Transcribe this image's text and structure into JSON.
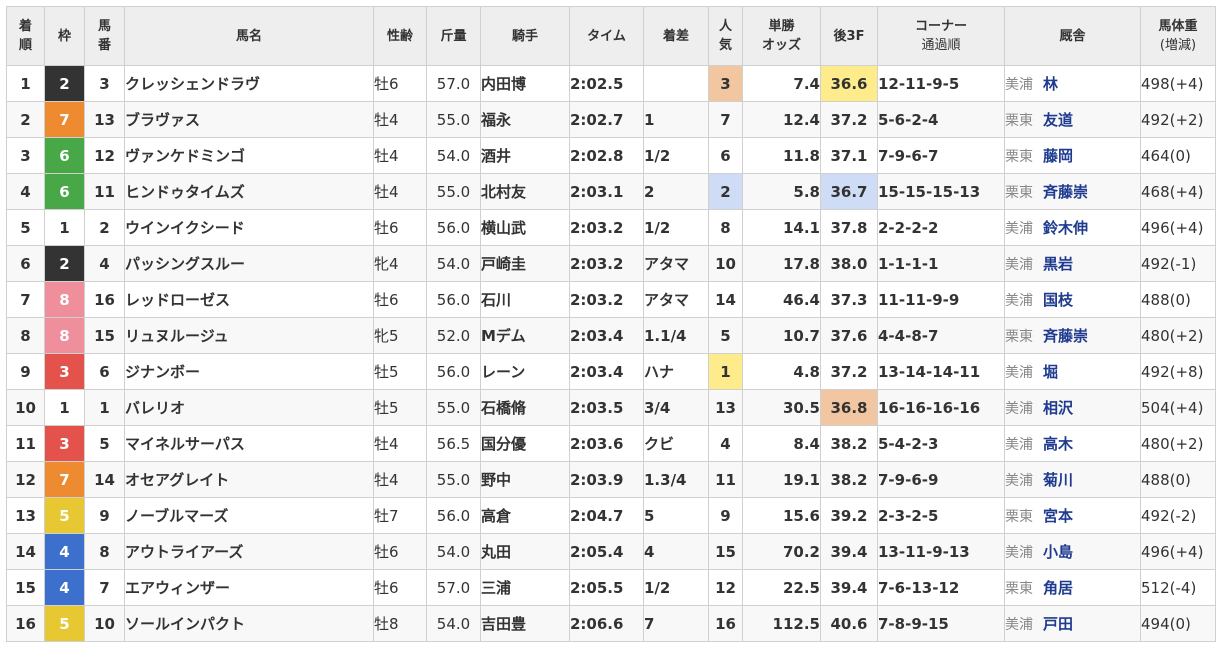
{
  "columns": [
    {
      "key": "rank",
      "label": "着\n順"
    },
    {
      "key": "frame",
      "label": "枠"
    },
    {
      "key": "num",
      "label": "馬\n番"
    },
    {
      "key": "name",
      "label": "馬名"
    },
    {
      "key": "sexage",
      "label": "性齢"
    },
    {
      "key": "wt",
      "label": "斤量"
    },
    {
      "key": "jockey",
      "label": "騎手"
    },
    {
      "key": "time",
      "label": "タイム"
    },
    {
      "key": "margin",
      "label": "着差"
    },
    {
      "key": "pop",
      "label": "人\n気"
    },
    {
      "key": "odds",
      "label": "単勝\nオッズ"
    },
    {
      "key": "last3f",
      "label": "後3F"
    },
    {
      "key": "corner",
      "label": "コーナー",
      "sub": "通過順"
    },
    {
      "key": "stable",
      "label": "厩舎"
    },
    {
      "key": "body",
      "label": "馬体重",
      "sub": "(増減)"
    }
  ],
  "colors": {
    "frames": {
      "1": {
        "bg": "#ffffff",
        "fg": "#333333"
      },
      "2": {
        "bg": "#333333",
        "fg": "#ffffff"
      },
      "3": {
        "bg": "#e4524c",
        "fg": "#ffffff"
      },
      "4": {
        "bg": "#3d6fcc",
        "fg": "#ffffff"
      },
      "5": {
        "bg": "#e8c832",
        "fg": "#ffffff"
      },
      "6": {
        "bg": "#48a848",
        "fg": "#ffffff"
      },
      "7": {
        "bg": "#ee8a30",
        "fg": "#ffffff"
      },
      "8": {
        "bg": "#ef8f9c",
        "fg": "#ffffff"
      }
    },
    "highlights": {
      "gold": "#fdeb8c",
      "bronze": "#f2c6a0",
      "blue": "#cfdcf5"
    }
  },
  "rows": [
    {
      "rank": "1",
      "frame": "2",
      "num": "3",
      "name": "クレッシェンドラヴ",
      "sexage": "牡6",
      "wt": "57.0",
      "jockey": "内田博",
      "time": "2:02.5",
      "margin": "",
      "pop": "3",
      "odds": "7.4",
      "last3f": "36.6",
      "corner": "12-11-9-5",
      "region": "美浦",
      "trainer": "林",
      "body": "498(+4)",
      "popHL": "bronze",
      "oddsHot": true,
      "l3fHL": "gold"
    },
    {
      "rank": "2",
      "frame": "7",
      "num": "13",
      "name": "ブラヴァス",
      "sexage": "牡4",
      "wt": "55.0",
      "jockey": "福永",
      "time": "2:02.7",
      "margin": "1",
      "pop": "7",
      "odds": "12.4",
      "last3f": "37.2",
      "corner": "5-6-2-4",
      "region": "栗東",
      "trainer": "友道",
      "body": "492(+2)"
    },
    {
      "rank": "3",
      "frame": "6",
      "num": "12",
      "name": "ヴァンケドミンゴ",
      "sexage": "牡4",
      "wt": "54.0",
      "jockey": "酒井",
      "time": "2:02.8",
      "margin": "1/2",
      "pop": "6",
      "odds": "11.8",
      "last3f": "37.1",
      "corner": "7-9-6-7",
      "region": "栗東",
      "trainer": "藤岡",
      "body": "464(0)"
    },
    {
      "rank": "4",
      "frame": "6",
      "num": "11",
      "name": "ヒンドゥタイムズ",
      "sexage": "牡4",
      "wt": "55.0",
      "jockey": "北村友",
      "time": "2:03.1",
      "margin": "2",
      "pop": "2",
      "odds": "5.8",
      "last3f": "36.7",
      "corner": "15-15-15-13",
      "region": "栗東",
      "trainer": "斉藤崇",
      "body": "468(+4)",
      "popHL": "blue",
      "oddsHot": true,
      "l3fHL": "blue"
    },
    {
      "rank": "5",
      "frame": "1",
      "num": "2",
      "name": "ウインイクシード",
      "sexage": "牡6",
      "wt": "56.0",
      "jockey": "横山武",
      "time": "2:03.2",
      "margin": "1/2",
      "pop": "8",
      "odds": "14.1",
      "last3f": "37.8",
      "corner": "2-2-2-2",
      "region": "美浦",
      "trainer": "鈴木伸",
      "body": "496(+4)"
    },
    {
      "rank": "6",
      "frame": "2",
      "num": "4",
      "name": "パッシングスルー",
      "sexage": "牝4",
      "wt": "54.0",
      "jockey": "戸崎圭",
      "time": "2:03.2",
      "margin": "アタマ",
      "pop": "10",
      "odds": "17.8",
      "last3f": "38.0",
      "corner": "1-1-1-1",
      "region": "美浦",
      "trainer": "黒岩",
      "body": "492(-1)"
    },
    {
      "rank": "7",
      "frame": "8",
      "num": "16",
      "name": "レッドローゼス",
      "sexage": "牡6",
      "wt": "56.0",
      "jockey": "石川",
      "time": "2:03.2",
      "margin": "アタマ",
      "pop": "14",
      "odds": "46.4",
      "last3f": "37.3",
      "corner": "11-11-9-9",
      "region": "美浦",
      "trainer": "国枝",
      "body": "488(0)"
    },
    {
      "rank": "8",
      "frame": "8",
      "num": "15",
      "name": "リュヌルージュ",
      "sexage": "牝5",
      "wt": "52.0",
      "jockey": "Mデム",
      "time": "2:03.4",
      "margin": "1.1/4",
      "pop": "5",
      "odds": "10.7",
      "last3f": "37.6",
      "corner": "4-4-8-7",
      "region": "栗東",
      "trainer": "斉藤崇",
      "body": "480(+2)"
    },
    {
      "rank": "9",
      "frame": "3",
      "num": "6",
      "name": "ジナンボー",
      "sexage": "牡5",
      "wt": "56.0",
      "jockey": "レーン",
      "time": "2:03.4",
      "margin": "ハナ",
      "pop": "1",
      "odds": "4.8",
      "last3f": "37.2",
      "corner": "13-14-14-11",
      "region": "美浦",
      "trainer": "堀",
      "body": "492(+8)",
      "popHL": "gold",
      "oddsHot": true
    },
    {
      "rank": "10",
      "frame": "1",
      "num": "1",
      "name": "バレリオ",
      "sexage": "牡5",
      "wt": "55.0",
      "jockey": "石橋脩",
      "time": "2:03.5",
      "margin": "3/4",
      "pop": "13",
      "odds": "30.5",
      "last3f": "36.8",
      "corner": "16-16-16-16",
      "region": "美浦",
      "trainer": "相沢",
      "body": "504(+4)",
      "l3fHL": "bronze"
    },
    {
      "rank": "11",
      "frame": "3",
      "num": "5",
      "name": "マイネルサーパス",
      "sexage": "牡4",
      "wt": "56.5",
      "jockey": "国分優",
      "time": "2:03.6",
      "margin": "クビ",
      "pop": "4",
      "odds": "8.4",
      "last3f": "38.2",
      "corner": "5-4-2-3",
      "region": "美浦",
      "trainer": "高木",
      "body": "480(+2)",
      "oddsHot": true
    },
    {
      "rank": "12",
      "frame": "7",
      "num": "14",
      "name": "オセアグレイト",
      "sexage": "牡4",
      "wt": "55.0",
      "jockey": "野中",
      "time": "2:03.9",
      "margin": "1.3/4",
      "pop": "11",
      "odds": "19.1",
      "last3f": "38.2",
      "corner": "7-9-6-9",
      "region": "美浦",
      "trainer": "菊川",
      "body": "488(0)"
    },
    {
      "rank": "13",
      "frame": "5",
      "num": "9",
      "name": "ノーブルマーズ",
      "sexage": "牡7",
      "wt": "56.0",
      "jockey": "高倉",
      "time": "2:04.7",
      "margin": "5",
      "pop": "9",
      "odds": "15.6",
      "last3f": "39.2",
      "corner": "2-3-2-5",
      "region": "栗東",
      "trainer": "宮本",
      "body": "492(-2)"
    },
    {
      "rank": "14",
      "frame": "4",
      "num": "8",
      "name": "アウトライアーズ",
      "sexage": "牡6",
      "wt": "54.0",
      "jockey": "丸田",
      "time": "2:05.4",
      "margin": "4",
      "pop": "15",
      "odds": "70.2",
      "last3f": "39.4",
      "corner": "13-11-9-13",
      "region": "美浦",
      "trainer": "小島",
      "body": "496(+4)"
    },
    {
      "rank": "15",
      "frame": "4",
      "num": "7",
      "name": "エアウィンザー",
      "sexage": "牡6",
      "wt": "57.0",
      "jockey": "三浦",
      "time": "2:05.5",
      "margin": "1/2",
      "pop": "12",
      "odds": "22.5",
      "last3f": "39.4",
      "corner": "7-6-13-12",
      "region": "栗東",
      "trainer": "角居",
      "body": "512(-4)"
    },
    {
      "rank": "16",
      "frame": "5",
      "num": "10",
      "name": "ソールインパクト",
      "sexage": "牡8",
      "wt": "54.0",
      "jockey": "吉田豊",
      "time": "2:06.6",
      "margin": "7",
      "pop": "16",
      "odds": "112.5",
      "last3f": "40.6",
      "corner": "7-8-9-15",
      "region": "美浦",
      "trainer": "戸田",
      "body": "494(0)"
    }
  ]
}
